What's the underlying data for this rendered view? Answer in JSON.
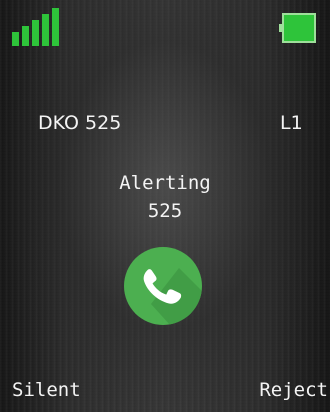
{
  "status_bar": {
    "signal_icon": "signal-strength-icon",
    "signal_bars": 5,
    "battery_icon": "battery-icon",
    "battery_level": 1.0,
    "accent_color": "#2ec43a"
  },
  "call": {
    "account": "DKO 525",
    "line": "L1",
    "status": "Alerting",
    "number": "525",
    "icon": "phone-handset-icon",
    "icon_color": "#4caf50"
  },
  "softkeys": {
    "left": "Silent",
    "right": "Reject"
  }
}
